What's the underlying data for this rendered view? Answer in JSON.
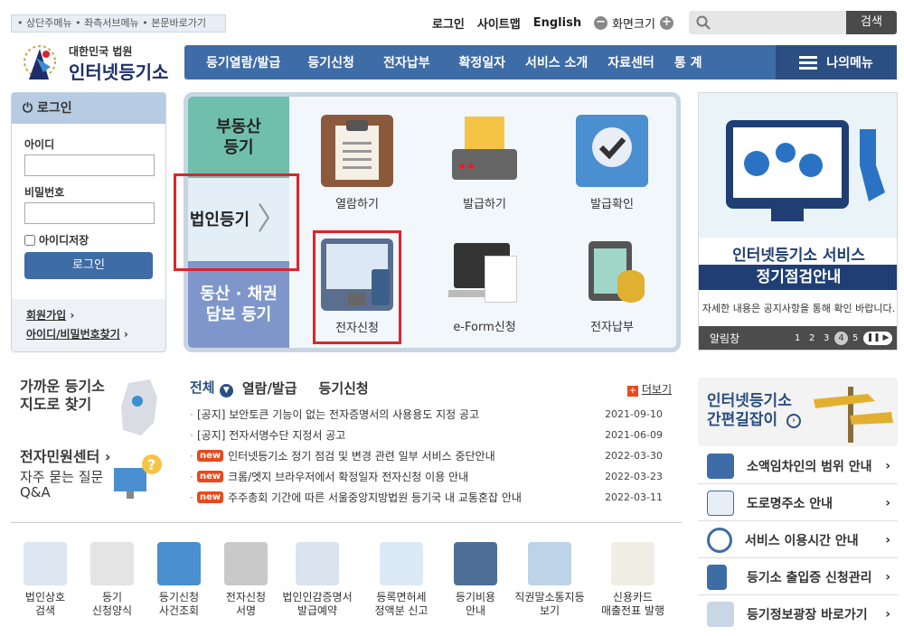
{
  "skip_links": "• 상단주메뉴 • 좌측서브메뉴 • 본문바로가기",
  "top": {
    "login": "로그인",
    "sitemap": "사이트맵",
    "english": "English",
    "zoom": "화면크기",
    "search_button": "검색",
    "search_placeholder": ""
  },
  "logo": {
    "line1": "대한민국 법원",
    "line2": "인터넷등기소"
  },
  "gnb": [
    "등기열람/발급",
    "등기신청",
    "전자납부",
    "확정일자",
    "서비스 소개",
    "자료센터",
    "통 계"
  ],
  "my_menu": "나의메뉴",
  "login": {
    "title": "로그인",
    "id_label": "아이디",
    "pw_label": "비밀번호",
    "save_id": "아이디저장",
    "button": "로그인",
    "join": "회원가입",
    "find": "아이디/비밀번호찾기"
  },
  "categories": {
    "real_estate": "부동산\n등기",
    "corporate": "법인등기",
    "movable": "동산 · 채권\n담보 등기"
  },
  "services": [
    "열람하기",
    "발급하기",
    "발급확인",
    "전자신청",
    "e-Form신청",
    "전자납부"
  ],
  "banner": {
    "title": "인터넷등기소 서비스",
    "subtitle": "정기점검안내",
    "desc": "자세한 내용은 공지사항을 통해 확인 바랍니다.",
    "bar": "알림창",
    "pages": [
      "1",
      "2",
      "3",
      "4",
      "5"
    ],
    "current": "4"
  },
  "near": {
    "map": "가까운 등기소\n지도로 찾기",
    "civil": "전자민원센터",
    "faq": "자주 묻는 질문\nQ&A"
  },
  "notice": {
    "tabs": [
      "전체",
      "열람/발급",
      "등기신청"
    ],
    "more": "더보기",
    "items": [
      {
        "new": false,
        "title": "[공지] 보안토큰 기능이 없는 전자증명서의 사용용도 지정 공고",
        "date": "2021-09-10"
      },
      {
        "new": false,
        "title": "[공지] 전자서명수단 지정서 공고",
        "date": "2021-06-09"
      },
      {
        "new": true,
        "title": "인터넷등기소 정기 점검 및 변경 관련 일부 서비스 중단안내",
        "date": "2022-03-30"
      },
      {
        "new": true,
        "title": "크롬/엣지 브라우저에서 확정일자 전자신청 이용 안내",
        "date": "2022-03-23"
      },
      {
        "new": true,
        "title": "주주총회 기간에 따른 서울중앙지방법원 등기국 내 교통혼잡 안내",
        "date": "2022-03-11"
      }
    ],
    "new_label": "new"
  },
  "quick": [
    "법인상호\n검색",
    "등기\n신청양식",
    "등기신청\n사건조회",
    "전자신청\n서명",
    "법인인감증명서\n발급예약",
    "등록면허세\n정액분 신고",
    "등기비용\n안내",
    "직권말소통지등\n보기",
    "신용카드\n매출전표 발행"
  ],
  "guide": "인터넷등기소\n간편길잡이",
  "right_links": [
    "소액임차인의 범위 안내",
    "도로명주소 안내",
    "서비스 이용시간 안내",
    "등기소 출입증 신청관리",
    "등기정보광장 바로가기"
  ],
  "colors": {
    "accent": "#3e6ca6",
    "dark": "#2b4f82",
    "red": "#e0232b"
  }
}
